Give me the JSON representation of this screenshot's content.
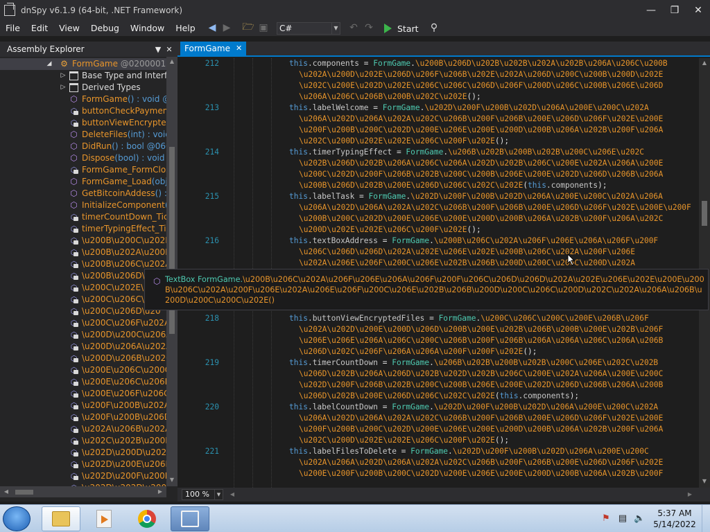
{
  "window": {
    "title": "dnSpy v6.1.9 (64-bit, .NET Framework)"
  },
  "menu": [
    "File",
    "Edit",
    "View",
    "Debug",
    "Window",
    "Help"
  ],
  "toolbar": {
    "language": "C#",
    "start_label": "Start"
  },
  "explorer": {
    "title": "Assembly Explorer",
    "items": [
      {
        "label": "FormGame",
        "suffix": " @02000012"
      },
      {
        "label": "Base Type and Interfaces"
      },
      {
        "label": "Derived Types"
      },
      {
        "label": "FormGame",
        "suffix": "() : void @0"
      },
      {
        "label": "buttonCheckPayment"
      },
      {
        "label": "buttonViewEncryptedF"
      },
      {
        "label": "DeleteFiles",
        "suffix": "(int) : void ("
      },
      {
        "label": "DidRun",
        "suffix": "() : bool @0600"
      },
      {
        "label": "Dispose",
        "suffix": "(bool) : void @"
      },
      {
        "label": "FormGame_FormClosi"
      },
      {
        "label": "FormGame_Load",
        "suffix": "(obje"
      },
      {
        "label": "GetBitcoinAddess",
        "suffix": "() : s"
      },
      {
        "label": "InitializeComponent",
        "suffix": "()"
      },
      {
        "label": "timerCountDown_Tick"
      },
      {
        "label": "timerTypingEffect_Tic"
      },
      {
        "label": "\\u200B\\u200C\\u202E\\"
      },
      {
        "label": "\\u200B\\u202A\\u200E\\"
      },
      {
        "label": "\\u200B\\u206C\\u202A\\"
      },
      {
        "label": "\\u200B\\u206D\\u202E"
      },
      {
        "label": "\\u200C\\u202E\\u206"
      },
      {
        "label": "\\u200C\\u206C\\u20"
      },
      {
        "label": "\\u200C\\u206D\\u20"
      },
      {
        "label": "\\u200C\\u206F\\u202A\\"
      },
      {
        "label": "\\u200D\\u200C\\u206A\\"
      },
      {
        "label": "\\u200D\\u206A\\u202A\\"
      },
      {
        "label": "\\u200D\\u206B\\u202C\\"
      },
      {
        "label": "\\u200E\\u206C\\u200C\\"
      },
      {
        "label": "\\u200E\\u206C\\u206D\\"
      },
      {
        "label": "\\u200E\\u206F\\u206C\\"
      },
      {
        "label": "\\u200F\\u200B\\u202A\\"
      },
      {
        "label": "\\u200F\\u200B\\u206D\\"
      },
      {
        "label": "\\u202A\\u206B\\u202A\\"
      },
      {
        "label": "\\u202C\\u202B\\u200B\\"
      },
      {
        "label": "\\u202D\\u200D\\u202D\\"
      },
      {
        "label": "\\u202D\\u200E\\u206D\\"
      },
      {
        "label": "\\u202D\\u200F\\u200B\\"
      },
      {
        "label": "\\u202D\\u202D\\u2006"
      }
    ]
  },
  "editor": {
    "tab": "FormGame",
    "zoom": "100 %",
    "lines": [
      {
        "num": "212",
        "text": "this.components = FormGame.\\u200B\\u206D\\u202B\\u202B\\u202A\\u202B\\u206A\\u206C\\u200B"
      },
      {
        "num": "",
        "text": "\\u202A\\u200D\\u202E\\u206D\\u206F\\u206B\\u202E\\u202A\\u206D\\u200C\\u200B\\u200D\\u202E"
      },
      {
        "num": "",
        "text": "\\u202C\\u200E\\u202D\\u202E\\u206C\\u206C\\u206D\\u206F\\u200D\\u206C\\u200B\\u206E\\u206D"
      },
      {
        "num": "",
        "text": "\\u206A\\u206C\\u206B\\u200B\\u202C\\u202E();"
      },
      {
        "num": "213",
        "text": "this.labelWelcome = FormGame.\\u202D\\u200F\\u200B\\u202D\\u206A\\u200E\\u200C\\u202A"
      },
      {
        "num": "",
        "text": "\\u206A\\u202D\\u206A\\u202A\\u202C\\u206B\\u200F\\u206B\\u200E\\u206D\\u206F\\u202E\\u200E"
      },
      {
        "num": "",
        "text": "\\u200F\\u200B\\u200C\\u202D\\u200E\\u206E\\u200E\\u200D\\u200B\\u206A\\u202B\\u200F\\u206A"
      },
      {
        "num": "",
        "text": "\\u202C\\u200D\\u202E\\u202E\\u206C\\u200F\\u202E();"
      },
      {
        "num": "214",
        "text": "this.timerTypingEffect = FormGame.\\u206B\\u202B\\u200B\\u202B\\u200C\\u206E\\u202C"
      },
      {
        "num": "",
        "text": "\\u202B\\u206D\\u202B\\u206A\\u206C\\u206A\\u202D\\u202B\\u206C\\u200E\\u202A\\u206A\\u200E"
      },
      {
        "num": "",
        "text": "\\u200C\\u202D\\u200F\\u206B\\u202B\\u200C\\u200B\\u206E\\u200E\\u202D\\u206D\\u206B\\u206A"
      },
      {
        "num": "",
        "text": "\\u200B\\u206D\\u202B\\u200E\\u206D\\u206C\\u202C\\u202E(this.components);"
      },
      {
        "num": "215",
        "text": "this.labelTask = FormGame.\\u202D\\u200F\\u200B\\u202D\\u206A\\u200E\\u200C\\u202A\\u206A"
      },
      {
        "num": "",
        "text": "\\u206A\\u202D\\u206A\\u202A\\u202C\\u206B\\u200F\\u206B\\u200E\\u206D\\u206F\\u202E\\u200E\\u200F"
      },
      {
        "num": "",
        "text": "\\u200B\\u200C\\u202D\\u200E\\u206E\\u200E\\u200D\\u200B\\u206A\\u202B\\u200F\\u206A\\u202C"
      },
      {
        "num": "",
        "text": "\\u200D\\u202E\\u202E\\u206C\\u200F\\u202E();"
      },
      {
        "num": "216",
        "text": "this.textBoxAddress = FormGame.\\u200B\\u206C\\u202A\\u206F\\u206E\\u206A\\u206F\\u200F"
      },
      {
        "num": "",
        "text": "\\u206C\\u206D\\u206D\\u202A\\u202E\\u206E\\u202E\\u200B\\u206C\\u202A\\u200F\\u206E"
      },
      {
        "num": "",
        "text": "\\u202A\\u206E\\u206F\\u200C\\u206E\\u202B\\u206B\\u200D\\u200C\\u206C\\u200D\\u202A"
      },
      {
        "num": "",
        "text": ""
      },
      {
        "num": "",
        "text": ""
      },
      {
        "num": "",
        "text": ""
      },
      {
        "num": "",
        "text": "\\u202C\\u206F\\u206A\\u206A\\u200F\\u202E();"
      },
      {
        "num": "218",
        "text": "this.buttonViewEncryptedFiles = FormGame.\\u200C\\u206C\\u200C\\u200E\\u206B\\u206F"
      },
      {
        "num": "",
        "text": "\\u202A\\u202D\\u200E\\u200D\\u206D\\u200B\\u200E\\u202B\\u206B\\u200B\\u200E\\u202B\\u206F"
      },
      {
        "num": "",
        "text": "\\u206E\\u206E\\u206A\\u206C\\u200C\\u206B\\u200F\\u206B\\u206A\\u206A\\u206C\\u206A\\u206B"
      },
      {
        "num": "",
        "text": "\\u206D\\u202C\\u206F\\u206A\\u206A\\u200F\\u200F\\u202E();"
      },
      {
        "num": "219",
        "text": "this.timerCountDown = FormGame.\\u206B\\u202B\\u200B\\u202B\\u200C\\u206E\\u202C\\u202B"
      },
      {
        "num": "",
        "text": "\\u206D\\u202B\\u206A\\u206D\\u202B\\u202D\\u202B\\u206C\\u200E\\u202A\\u206A\\u200E\\u200C"
      },
      {
        "num": "",
        "text": "\\u202D\\u200F\\u206B\\u202B\\u200C\\u200B\\u206E\\u200E\\u202D\\u206D\\u206B\\u206A\\u200B"
      },
      {
        "num": "",
        "text": "\\u206D\\u202B\\u200E\\u206D\\u206C\\u202C\\u202E(this.components);"
      },
      {
        "num": "220",
        "text": "this.labelCountDown = FormGame.\\u202D\\u200F\\u200B\\u202D\\u206A\\u200E\\u200C\\u202A"
      },
      {
        "num": "",
        "text": "\\u206A\\u202D\\u206A\\u202A\\u202C\\u206B\\u200F\\u206B\\u200E\\u206D\\u206F\\u202E\\u200E"
      },
      {
        "num": "",
        "text": "\\u200F\\u200B\\u200C\\u202D\\u200E\\u206E\\u200E\\u200D\\u200B\\u206A\\u202B\\u200F\\u206A"
      },
      {
        "num": "",
        "text": "\\u202C\\u200D\\u202E\\u202E\\u206C\\u200F\\u202E();"
      },
      {
        "num": "221",
        "text": "this.labelFilesToDelete = FormGame.\\u202D\\u200F\\u200B\\u202D\\u206A\\u200E\\u200C"
      },
      {
        "num": "",
        "text": "\\u202A\\u206A\\u202D\\u206A\\u202A\\u202C\\u206B\\u200F\\u206B\\u200E\\u206D\\u206F\\u202E"
      },
      {
        "num": "",
        "text": "\\u200E\\u200F\\u200B\\u200C\\u202D\\u200E\\u206E\\u200E\\u200D\\u200B\\u206A\\u202B\\u200F"
      }
    ]
  },
  "tooltip": {
    "prefix": "TextBox FormGame.",
    "text": "\\u200B\\u206C\\u202A\\u206F\\u206E\\u206A\\u206F\\u200F\\u206C\\u206D\\u206D\\u202A\\u202E\\u206E\\u202E\\u200E\\u200B\\u206C\\u202A\\u200F\\u206E\\u202A\\u206E\\u206F\\u200C\\u206E\\u202B\\u206B\\u200D\\u200C\\u206C\\u200D\\u202C\\u202A\\u206A\\u206B\\u200D\\u200C\\u200C\\u202E()"
  },
  "clock": {
    "time": "5:37 AM",
    "date": "5/14/2022"
  },
  "colors": {
    "accent": "#007acc",
    "orange": "#e8952b",
    "keyword": "#569cd6"
  },
  "icons": {
    "window_app": "dnspy-window-icon",
    "navigate_back": "back-arrow-icon",
    "navigate_forward": "forward-arrow-icon",
    "open": "open-folder-icon",
    "save": "save-icon",
    "undo": "undo-icon",
    "redo": "redo-icon",
    "search": "search-icon"
  }
}
